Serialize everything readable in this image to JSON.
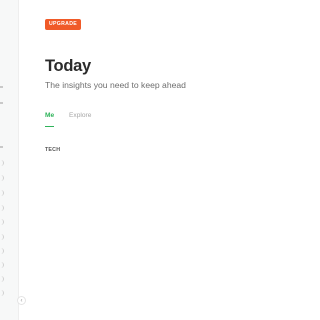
{
  "header": {
    "upgrade_label": "UPGRADE",
    "title": "Today",
    "subtitle": "The insights you need to keep ahead"
  },
  "tabs": [
    {
      "label": "Me",
      "active": true
    },
    {
      "label": "Explore",
      "active": false
    }
  ],
  "sections": [
    {
      "label": "TECH"
    }
  ],
  "colors": {
    "accent_orange": "#f05a28",
    "accent_green": "#2fb35a"
  },
  "icons": {
    "collapse": "chevron-left-icon"
  }
}
